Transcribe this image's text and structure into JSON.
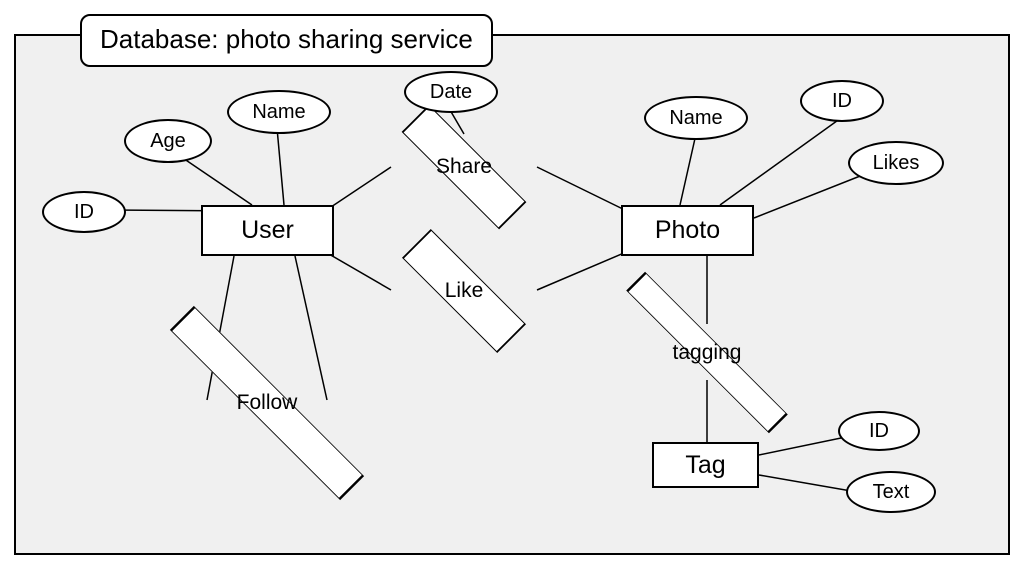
{
  "title": "Database: photo sharing service",
  "entities": {
    "user": "User",
    "photo": "Photo",
    "tag": "Tag"
  },
  "relationships": {
    "share": "Share",
    "like": "Like",
    "follow": "Follow",
    "tagging": "tagging"
  },
  "attributes": {
    "user_id": "ID",
    "user_age": "Age",
    "user_name": "Name",
    "share_date": "Date",
    "photo_name": "Name",
    "photo_id": "ID",
    "photo_likes": "Likes",
    "tag_id": "ID",
    "tag_text": "Text"
  }
}
